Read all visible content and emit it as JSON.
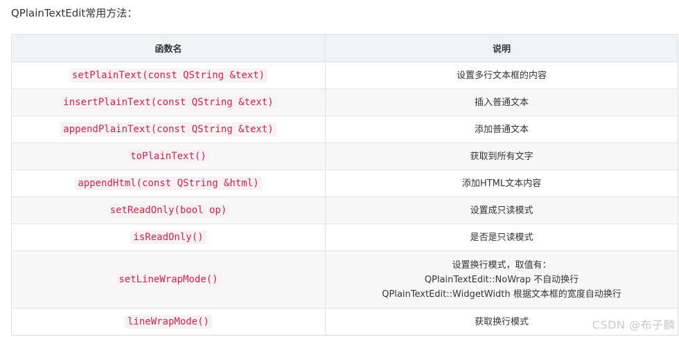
{
  "intro": "QPlainTextEdit常用方法：",
  "table": {
    "headers": [
      "函数名",
      "说明"
    ],
    "rows": [
      {
        "func": "setPlainText(const QString &text)",
        "desc": [
          "设置多行文本框的内容"
        ]
      },
      {
        "func": "insertPlainText(const QString &text)",
        "desc": [
          "插入普通文本"
        ]
      },
      {
        "func": "appendPlainText(const QString &text)",
        "desc": [
          "添加普通文本"
        ]
      },
      {
        "func": "toPlainText()",
        "desc": [
          "获取到所有文字"
        ]
      },
      {
        "func": "appendHtml(const QString &html)",
        "desc": [
          "添加HTML文本内容"
        ]
      },
      {
        "func": "setReadOnly(bool op)",
        "desc": [
          "设置成只读模式"
        ]
      },
      {
        "func": "isReadOnly()",
        "desc": [
          "是否是只读模式"
        ]
      },
      {
        "func": "setLineWrapMode()",
        "desc": [
          "设置换行模式，取值有：",
          "QPlainTextEdit::NoWrap 不自动换行",
          "QPlainTextEdit::WidgetWidth 根据文本框的宽度自动换行"
        ]
      },
      {
        "func": "lineWrapMode()",
        "desc": [
          "获取换行模式"
        ]
      }
    ]
  },
  "watermark": "CSDN @布子麟"
}
